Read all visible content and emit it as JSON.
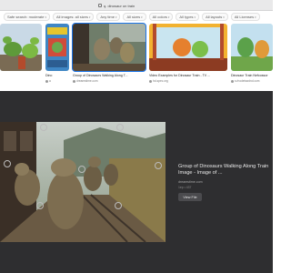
{
  "browser": {
    "url": "q. dinosaur on train"
  },
  "filters": [
    {
      "label": "Safe search: moderate"
    },
    {
      "label": "All images: all sizes"
    },
    {
      "label": "Any time"
    },
    {
      "label": "All sizes"
    },
    {
      "label": "All colors"
    },
    {
      "label": "All types"
    },
    {
      "label": "All layouts"
    },
    {
      "label": "All Licenses"
    }
  ],
  "thumbnails": [
    {
      "caption": "",
      "source": ""
    },
    {
      "caption": "Dino",
      "source": "a"
    },
    {
      "caption": "Group of Dinosaurs Walking Along T...",
      "source": "dreamstime.com"
    },
    {
      "caption": "",
      "source": ""
    },
    {
      "caption": "Video Examples for Dinosaur Train - TV ...",
      "source": "hd-spec.org"
    },
    {
      "caption": "Dinosaur Train Nefcossor",
      "source": "s.rhodeiswdnd.com"
    }
  ],
  "preview": {
    "title": "Group of Dinosaurs Walking Along Train Image - Image of ...",
    "site": "dreamstime.com",
    "meta": "1ep • 437",
    "button": "View File"
  },
  "colors": {
    "accent": "#1a73e8",
    "panel": "#2e2e30"
  }
}
